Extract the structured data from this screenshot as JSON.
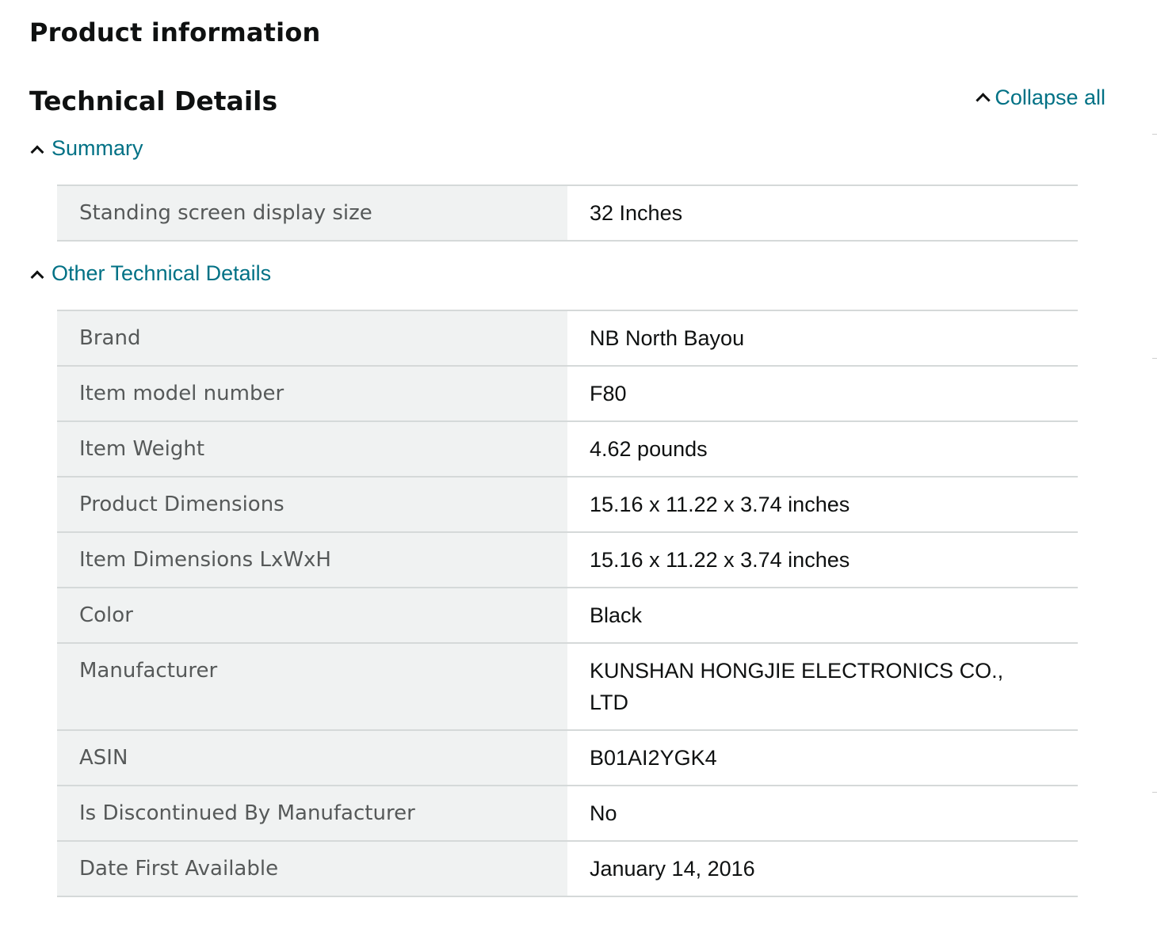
{
  "page": {
    "title": "Product information"
  },
  "technical_details": {
    "title": "Technical Details",
    "collapse_all_label": "Collapse all",
    "summary": {
      "header": "Summary",
      "rows": [
        {
          "label": "Standing screen display size",
          "value": "32 Inches"
        }
      ]
    },
    "other": {
      "header": "Other Technical Details",
      "rows": [
        {
          "label": "Brand",
          "value": "NB North Bayou"
        },
        {
          "label": "Item model number",
          "value": "F80"
        },
        {
          "label": "Item Weight",
          "value": "4.62 pounds"
        },
        {
          "label": "Product Dimensions",
          "value": "15.16 x 11.22 x 3.74 inches"
        },
        {
          "label": "Item Dimensions LxWxH",
          "value": "15.16 x 11.22 x 3.74 inches"
        },
        {
          "label": "Color",
          "value": "Black"
        },
        {
          "label": "Manufacturer",
          "value": "KUNSHAN HONGJIE ELECTRONICS CO., LTD"
        },
        {
          "label": "ASIN",
          "value": "B01AI2YGK4"
        },
        {
          "label": "Is Discontinued By Manufacturer",
          "value": "No"
        },
        {
          "label": "Date First Available",
          "value": "January 14, 2016"
        }
      ]
    }
  },
  "colors": {
    "link": "#007185",
    "label_bg": "#f0f2f2",
    "label_text": "#565959",
    "border": "#d5d9d9",
    "text": "#0f1111"
  },
  "icons": {
    "collapse_all": "chevron-up-icon",
    "group_toggle": "chevron-up-icon"
  }
}
